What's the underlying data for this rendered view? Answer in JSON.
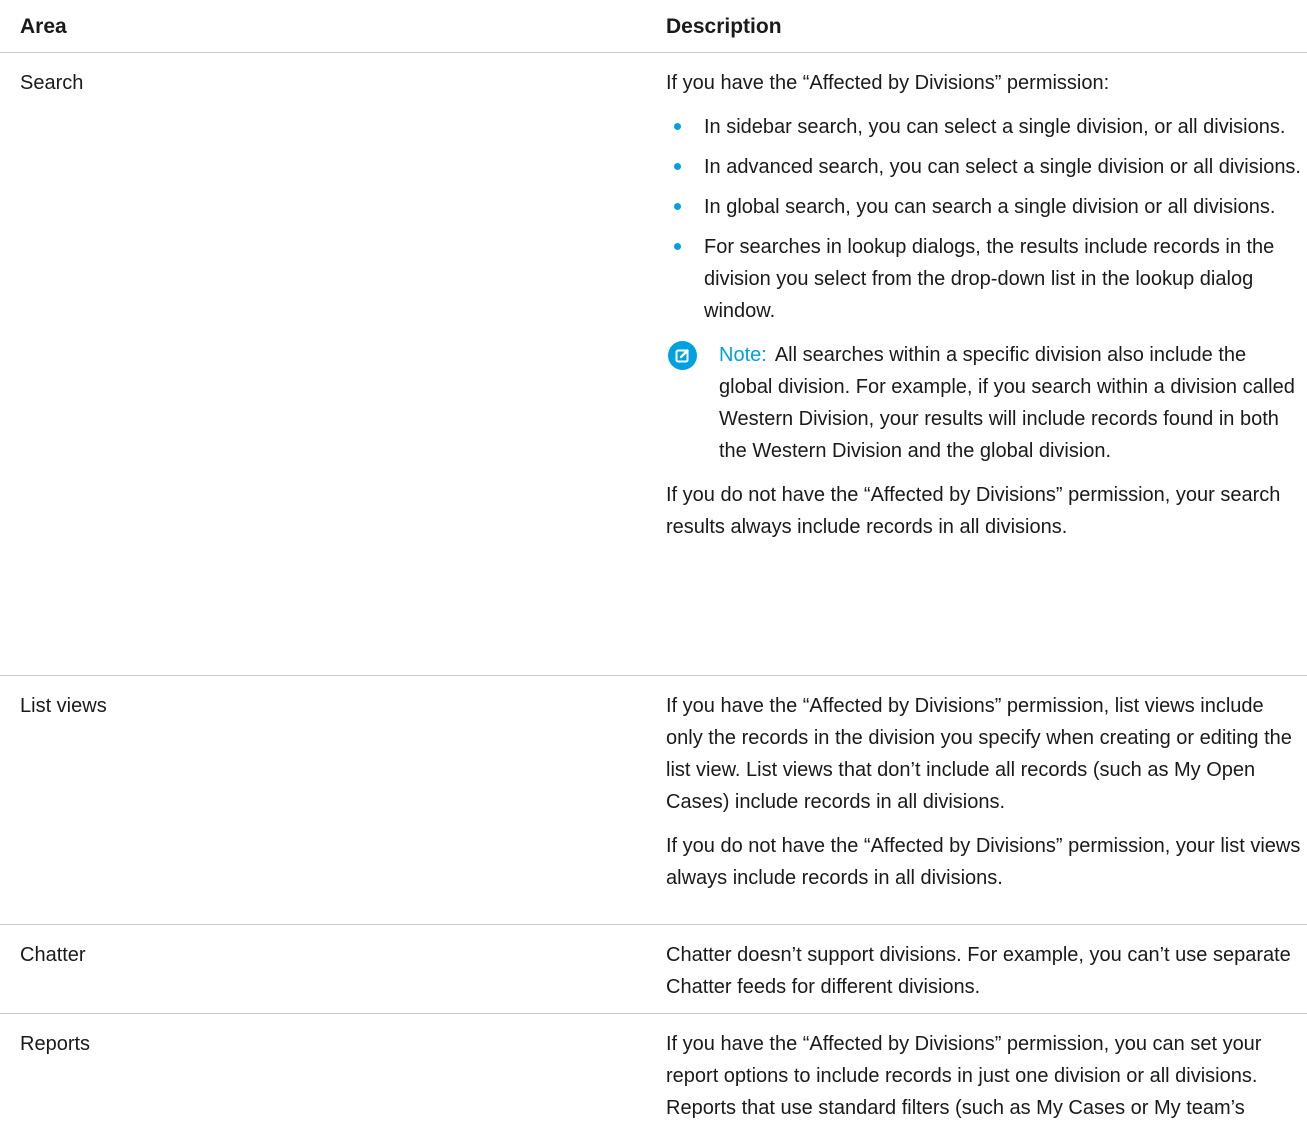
{
  "header": {
    "area": "Area",
    "description": "Description"
  },
  "rows": [
    {
      "area": "Search",
      "intro": "If you have the “Affected by Divisions” permission:",
      "bullets": [
        "In sidebar search, you can select a single division, or all divisions.",
        "In advanced search, you can select a single division or all divisions.",
        "In global search, you can search a single division or all divisions.",
        "For searches in lookup dialogs, the results include records in the division you select from the drop-down list in the lookup dialog window."
      ],
      "note_label": "Note:",
      "note_text": "All searches within a specific division also include the global division. For example, if you search within a division called Western Division, your results will include records found in both the Western Division and the global division.",
      "outro": "If you do not have the “Affected by Divisions” permission, your search results always include records in all divisions."
    },
    {
      "area": "List views",
      "paragraphs": [
        "If you have the “Affected by Divisions” permission, list views include only the records in the division you specify when creating or editing the list view. List views that don’t include all records (such as My Open Cases) include records in all divisions.",
        "If you do not have the “Affected by Divisions” permission, your list views always include records in all divisions."
      ]
    },
    {
      "area": "Chatter",
      "paragraphs": [
        "Chatter doesn’t support divisions. For example, you can’t use separate Chatter feeds for different divisions."
      ]
    },
    {
      "area": "Reports",
      "paragraphs": [
        "If you have the “Affected by Divisions” permission, you can set your report options to include records in just one division or all divisions. Reports that use standard filters (such as My Cases or My team’s"
      ]
    }
  ],
  "colors": {
    "accent": "#00a1e0",
    "divider": "#c9c9c9",
    "text": "#1a1a1a"
  },
  "icons": {
    "bullet": "bullet-dot-icon",
    "note": "note-edit-icon"
  }
}
